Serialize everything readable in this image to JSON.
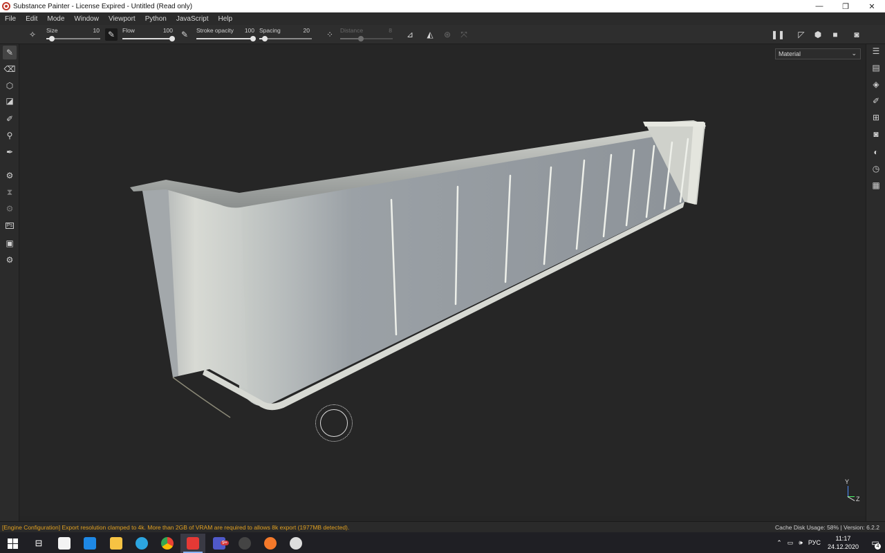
{
  "window": {
    "title": "Substance Painter - License Expired - Untitled (Read only)",
    "minimize": "—",
    "restore": "❐",
    "close": "✕"
  },
  "menu": [
    "File",
    "Edit",
    "Mode",
    "Window",
    "Viewport",
    "Python",
    "JavaScript",
    "Help"
  ],
  "toolbar": {
    "size": {
      "label": "Size",
      "value": "10",
      "level": 0.1
    },
    "flow": {
      "label": "Flow",
      "value": "100",
      "level": 1.0
    },
    "stroke_opacity": {
      "label": "Stroke opacity",
      "value": "100",
      "level": 1.0
    },
    "spacing": {
      "label": "Spacing",
      "value": "20",
      "level": 0.1
    },
    "distance": {
      "label": "Distance",
      "value": "8",
      "level": 0.4
    }
  },
  "viewport": {
    "channel_select": "Material",
    "axis_y": "Y",
    "axis_z": "Z"
  },
  "left_tools": [
    "paint-brush-icon",
    "eraser-icon",
    "projection-icon",
    "polygon-fill-icon",
    "smudge-icon",
    "clone-icon",
    "color-picker-icon",
    "settings-icon",
    "hourglass-icon",
    "gear-icon",
    "photoshop-icon",
    "export-icon",
    "plugin-icon"
  ],
  "right_tools": [
    "layers-icon",
    "texture-set-icon",
    "stack-icon",
    "brush-icon",
    "uv-icon",
    "display-icon",
    "environment-icon",
    "history-icon",
    "log-icon"
  ],
  "status": {
    "message": "[Engine Configuration] Export resolution clamped to 4k. More than 2GB of VRAM are required to allows 8k export (1977MB detected).",
    "cache": "Cache Disk Usage:   58% | Version: 6.2.2"
  },
  "taskbar": {
    "language": "РУС",
    "time": "11:17",
    "date": "24.12.2020",
    "notifications": "4",
    "teams_badge": "9+"
  },
  "colors": {
    "accent": "#e0a020",
    "brand": "#c0392b"
  }
}
